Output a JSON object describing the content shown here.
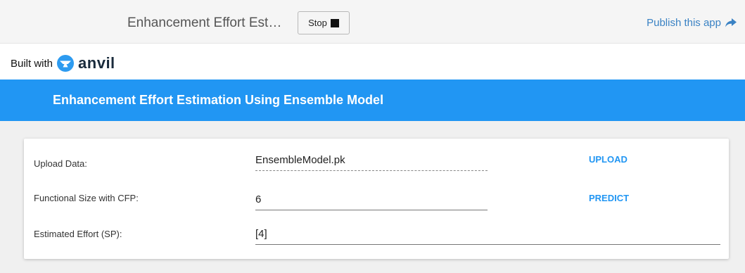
{
  "topbar": {
    "app_title": "Enhancement Effort Est…",
    "stop_label": "Stop",
    "publish_label": "Publish this app"
  },
  "branding": {
    "built_with_label": "Built with",
    "logo_text": "anvil"
  },
  "banner": {
    "title": "Enhancement Effort Estimation Using Ensemble Model"
  },
  "form": {
    "upload_label": "Upload Data:",
    "upload_value": "EnsembleModel.pk",
    "upload_button": "UPLOAD",
    "size_label": "Functional Size with CFP:",
    "size_value": "6",
    "predict_button": "PREDICT",
    "effort_label": "Estimated Effort (SP):",
    "effort_value": "[4]"
  },
  "colors": {
    "accent": "#2196f3",
    "link": "#3a82c4",
    "banner_text": "#ffffff"
  },
  "icons": [
    "stop-square-icon",
    "share-arrow-icon",
    "anvil-logo-icon"
  ]
}
